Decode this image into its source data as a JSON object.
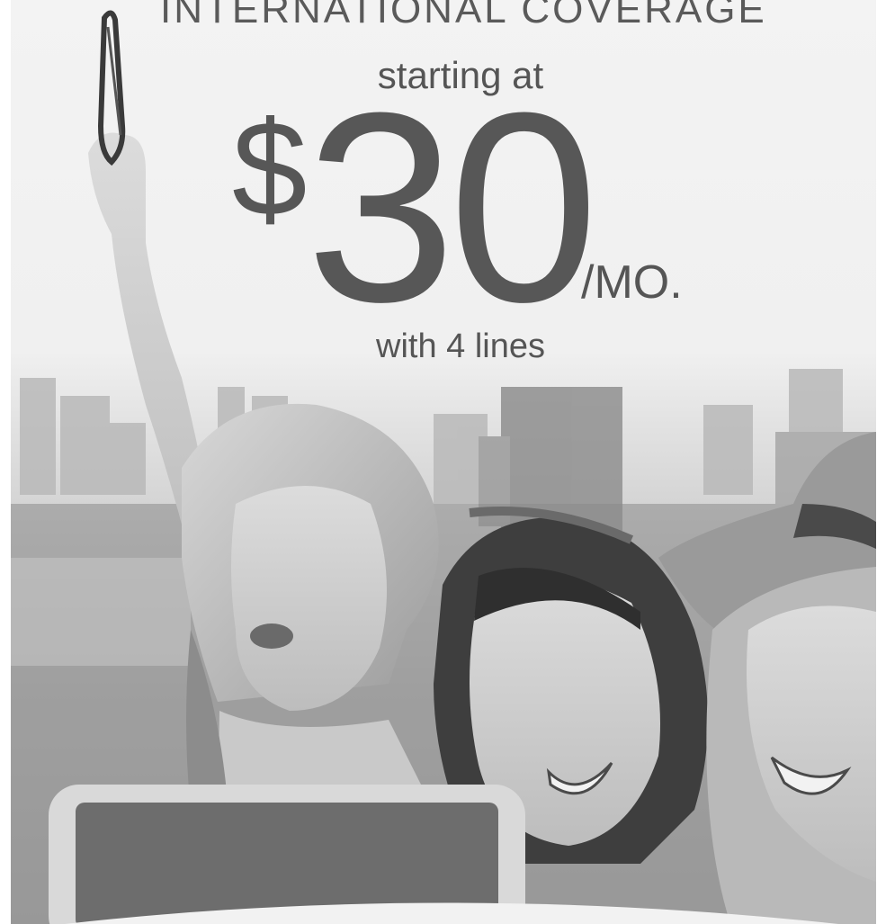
{
  "ad": {
    "headline": "INTERNATIONAL COVERAGE",
    "starting_text": "starting at",
    "currency_symbol": "$",
    "price": "30",
    "per_period": "/MO.",
    "lines_text": "with 4 lines"
  },
  "colors": {
    "text": "#575757",
    "background": "#f2f2f2"
  }
}
